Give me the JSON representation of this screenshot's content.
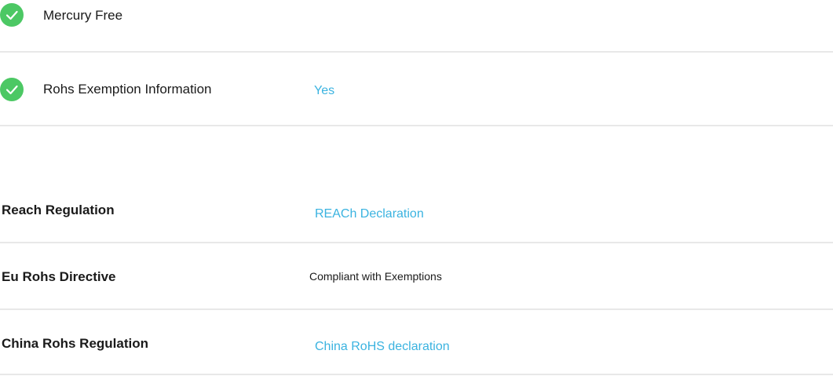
{
  "features": [
    {
      "label": "Mercury Free",
      "value": "",
      "icon": "check-circle-icon"
    },
    {
      "label": "Rohs Exemption Information",
      "value": "Yes",
      "icon": "check-circle-icon"
    }
  ],
  "regulations": [
    {
      "label": "Reach Regulation",
      "value": "REACh Declaration",
      "value_type": "link"
    },
    {
      "label": "Eu Rohs Directive",
      "value": "Compliant with Exemptions",
      "value_type": "text"
    },
    {
      "label": "China Rohs Regulation",
      "value": "China RoHS declaration",
      "value_type": "link"
    }
  ],
  "colors": {
    "check": "#4cc864",
    "link": "#3ab3e0",
    "divider": "#e8e8e8"
  }
}
